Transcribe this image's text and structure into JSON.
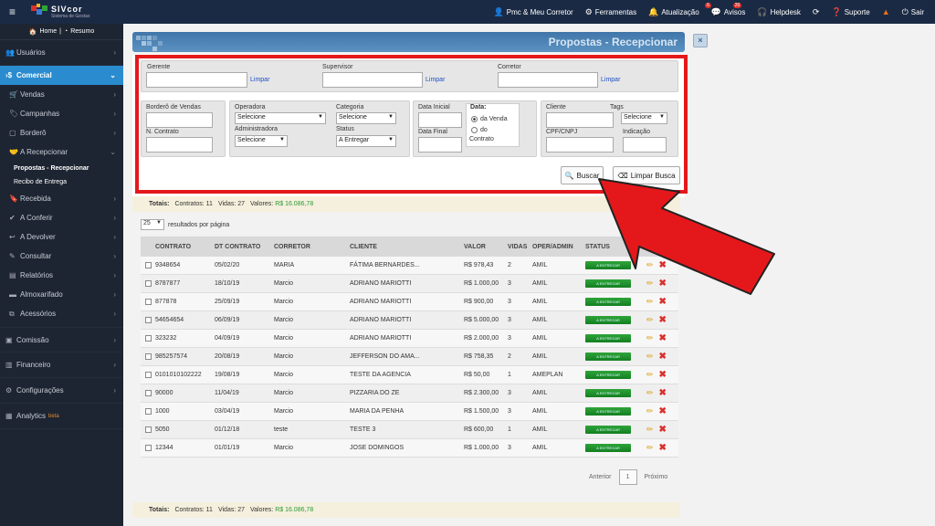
{
  "topbar": {
    "logo_title": "SIVcor",
    "logo_sub": "Sistema de Gestao",
    "items": [
      {
        "label": "Pmc & Meu Corretor",
        "icon": "user-icon"
      },
      {
        "label": "Ferramentas",
        "icon": "wrench-icon"
      },
      {
        "label": "Atualização",
        "icon": "bell-icon",
        "badge": "6"
      },
      {
        "label": "Avisos",
        "icon": "chat-icon",
        "badge": "20"
      },
      {
        "label": "Helpdesk",
        "icon": "headset-icon"
      },
      {
        "label": "",
        "icon": "refresh-icon"
      },
      {
        "label": "Suporte",
        "icon": "help-icon"
      },
      {
        "label": "",
        "icon": "warning-icon"
      },
      {
        "label": "Sair",
        "icon": "power-icon"
      }
    ]
  },
  "sidebar": {
    "home": "Home",
    "resumo": "Resumo",
    "usuarios": "Usuários",
    "comercial": "Comercial",
    "vendas": "Vendas",
    "campanhas": "Campanhas",
    "bordero": "Borderô",
    "a_recepcionar": "A Recepcionar",
    "propostas_recepcionar": "Propostas - Recepcionar",
    "recibo_entrega": "Recibo de Entrega",
    "recebida": "Recebida",
    "a_conferir": "A Conferir",
    "a_devolver": "A Devolver",
    "consultar": "Consultar",
    "relatorios": "Relatórios",
    "almoxarifado": "Almoxarifado",
    "acessorios": "Acessórios",
    "comissao": "Comissão",
    "financeiro": "Financeiro",
    "configuracoes": "Configurações",
    "analytics": "Analytics",
    "analytics_badge": "beta"
  },
  "page": {
    "title": "Propostas - Recepcionar",
    "close": "×"
  },
  "filters": {
    "gerente": "Gerente",
    "supervisor": "Supervisor",
    "corretor": "Corretor",
    "limpar": "Limpar",
    "bordero_vendas": "Borderô de Vendas",
    "n_contrato": "N. Contrato",
    "operadora": "Operadora",
    "operadora_value": "Selecione",
    "administradora": "Administradora",
    "administradora_value": "Selecione",
    "categoria": "Categoria",
    "categoria_value": "Selecione",
    "status": "Status",
    "status_value": "A Entregar",
    "data_inicial": "Data Inicial",
    "data_final": "Data Final",
    "data": "Data:",
    "da_venda": "da Venda",
    "do": "do",
    "contrato": "Contrato",
    "cliente": "Cliente",
    "tags": "Tags",
    "tags_value": "Selecione",
    "cpf_cnpj": "CPF/CNPJ",
    "indicacao": "Indicação",
    "buscar": "Buscar",
    "limpar_busca": "Limpar Busca"
  },
  "totals": {
    "label": "Totais:",
    "contratos": "Contratos: 11",
    "vidas": "Vidas: 27",
    "valores_label": "Valores:",
    "valores": "R$ 16.086,78"
  },
  "perpage": {
    "value": "25",
    "label": "resultados por página"
  },
  "table": {
    "headers": [
      "CONTRATO",
      "DT CONTRATO",
      "CORRETOR",
      "CLIENTE",
      "VALOR",
      "VIDAS",
      "OPER/ADMIN",
      "STATUS"
    ],
    "status_label": "A ENTREGAR",
    "rows": [
      [
        "9348654",
        "05/02/20",
        "MARIA",
        "FÁTIMA BERNARDES...",
        "R$ 978,43",
        "2",
        "AMIL"
      ],
      [
        "8787877",
        "18/10/19",
        "Marcio",
        "ADRIANO MARIOTTI",
        "R$ 1.000,00",
        "3",
        "AMIL"
      ],
      [
        "877878",
        "25/09/19",
        "Marcio",
        "ADRIANO MARIOTTI",
        "R$ 900,00",
        "3",
        "AMIL"
      ],
      [
        "54654654",
        "06/09/19",
        "Marcio",
        "ADRIANO MARIOTTI",
        "R$ 5.000,00",
        "3",
        "AMIL"
      ],
      [
        "323232",
        "04/09/19",
        "Marcio",
        "ADRIANO MARIOTTI",
        "R$ 2.000,00",
        "3",
        "AMIL"
      ],
      [
        "985257574",
        "20/08/19",
        "Marcio",
        "JEFFERSON DO AMA...",
        "R$ 758,35",
        "2",
        "AMIL"
      ],
      [
        "0101010102222",
        "19/08/19",
        "Marcio",
        "TESTE DA AGENCIA",
        "R$ 50,00",
        "1",
        "AMEPLAN"
      ],
      [
        "90000",
        "11/04/19",
        "Marcio",
        "PIZZARIA DO ZE",
        "R$ 2.300,00",
        "3",
        "AMIL"
      ],
      [
        "1000",
        "03/04/19",
        "Marcio",
        "MARIA DA PENHA",
        "R$ 1.500,00",
        "3",
        "AMIL"
      ],
      [
        "5050",
        "01/12/18",
        "teste",
        "TESTE 3",
        "R$ 600,00",
        "1",
        "AMIL"
      ],
      [
        "12344",
        "01/01/19",
        "Marcio",
        "JOSE DOMINGOS",
        "R$ 1.000,00",
        "3",
        "AMIL"
      ]
    ]
  },
  "pager": {
    "anterior": "Anterior",
    "page": "1",
    "proximo": "Próximo"
  },
  "colors": {
    "highlight": "#e4181b",
    "accent": "#2a8ccf",
    "status_green": "#1e9a2f"
  }
}
